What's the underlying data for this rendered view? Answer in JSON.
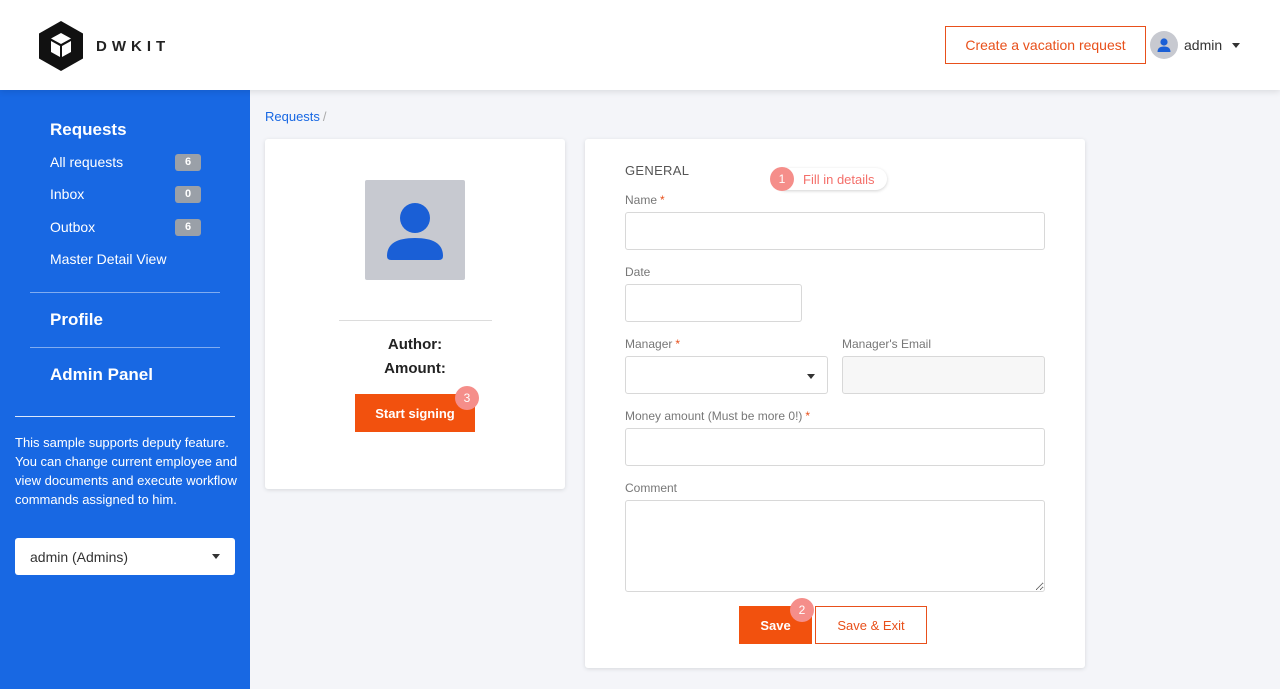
{
  "header": {
    "logo_text": "DWKIT",
    "create_button_label": "Create a vacation request",
    "user_name": "admin"
  },
  "sidebar": {
    "requests_heading": "Requests",
    "items": [
      {
        "label": "All requests",
        "badge": "6"
      },
      {
        "label": "Inbox",
        "badge": "0"
      },
      {
        "label": "Outbox",
        "badge": "6"
      },
      {
        "label": "Master Detail View"
      }
    ],
    "profile_heading": "Profile",
    "admin_heading": "Admin Panel",
    "note": "This sample supports deputy feature. You can change current employee and view documents and execute workflow commands assigned to him.",
    "employee_select_value": "admin (Admins)"
  },
  "breadcrumb": {
    "item": "Requests",
    "separator": "/"
  },
  "summary_card": {
    "author_label": "Author:",
    "amount_label": "Amount:",
    "start_signing_label": "Start signing"
  },
  "form": {
    "section_title": "GENERAL",
    "name_label": "Name",
    "date_label": "Date",
    "manager_label": "Manager",
    "manager_email_label": "Manager's Email",
    "amount_label": "Money amount (Must be more 0!)",
    "comment_label": "Comment",
    "required_mark": "*",
    "save_label": "Save",
    "save_exit_label": "Save & Exit"
  },
  "steps": [
    {
      "number": "1",
      "text": "Fill in details"
    },
    {
      "number": "2"
    },
    {
      "number": "3"
    }
  ],
  "colors": {
    "sidebar_bg": "#1868e3",
    "accent_orange": "#f2510e",
    "step_pink": "#f58e8a"
  }
}
